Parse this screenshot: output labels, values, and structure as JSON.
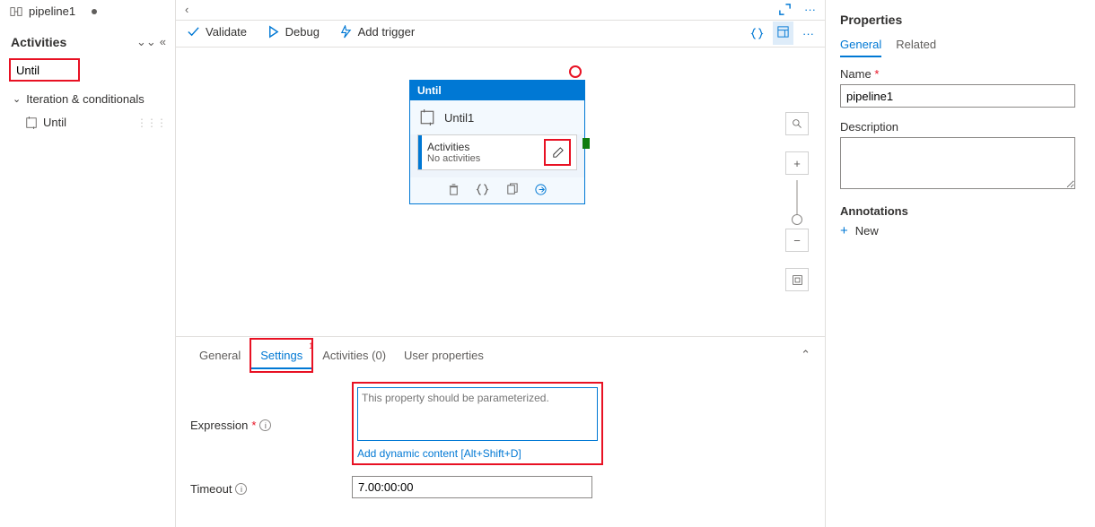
{
  "left": {
    "tab_name": "pipeline1",
    "activities_title": "Activities",
    "search_value": "Until",
    "section_label": "Iteration & conditionals",
    "activity_item": "Until"
  },
  "toolbar": {
    "validate": "Validate",
    "debug": "Debug",
    "add_trigger": "Add trigger"
  },
  "node": {
    "type": "Until",
    "name": "Until1",
    "sub_label": "Activities",
    "sub_text": "No activities"
  },
  "bottom": {
    "tabs": {
      "general": "General",
      "settings": "Settings",
      "activities": "Activities (0)",
      "user_props": "User properties"
    },
    "settings_badge": "1",
    "expression_label": "Expression",
    "expression_placeholder": "This property should be parameterized.",
    "dynamic_link": "Add dynamic content [Alt+Shift+D]",
    "timeout_label": "Timeout",
    "timeout_value": "7.00:00:00"
  },
  "right": {
    "title": "Properties",
    "tabs": {
      "general": "General",
      "related": "Related"
    },
    "name_label": "Name",
    "name_value": "pipeline1",
    "desc_label": "Description",
    "annotations_label": "Annotations",
    "new_label": "New"
  }
}
